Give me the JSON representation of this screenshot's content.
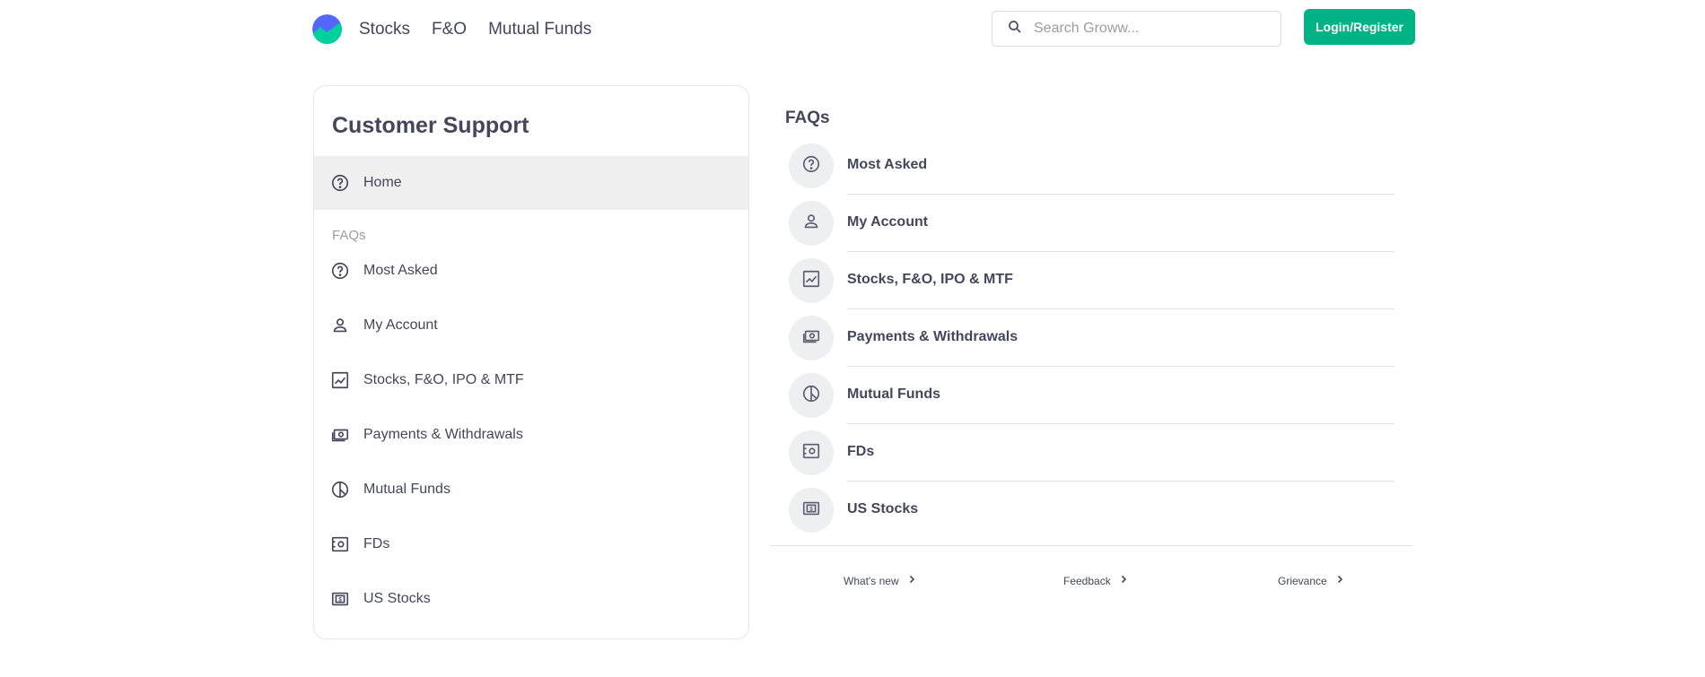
{
  "header": {
    "nav": [
      "Stocks",
      "F&O",
      "Mutual Funds"
    ],
    "search_placeholder": "Search Groww...",
    "login_label": "Login/Register"
  },
  "sidebar": {
    "title": "Customer Support",
    "home_label": "Home",
    "section_label": "FAQs",
    "items": [
      {
        "label": "Most Asked",
        "icon": "help-circle-icon"
      },
      {
        "label": "My Account",
        "icon": "user-icon"
      },
      {
        "label": "Stocks, F&O, IPO & MTF",
        "icon": "chart-line-icon"
      },
      {
        "label": "Payments & Withdrawals",
        "icon": "cash-icon"
      },
      {
        "label": "Mutual Funds",
        "icon": "pie-chart-icon"
      },
      {
        "label": "FDs",
        "icon": "safe-icon"
      },
      {
        "label": "US Stocks",
        "icon": "dollar-note-icon"
      }
    ]
  },
  "main": {
    "title": "FAQs",
    "items": [
      {
        "label": "Most Asked"
      },
      {
        "label": "My Account"
      },
      {
        "label": "Stocks, F&O, IPO & MTF"
      },
      {
        "label": "Payments & Withdrawals"
      },
      {
        "label": "Mutual Funds"
      },
      {
        "label": "FDs"
      },
      {
        "label": "US Stocks"
      }
    ],
    "footer_links": [
      "What's new",
      "Feedback",
      "Grievance"
    ]
  },
  "colors": {
    "accent": "#00b386",
    "text": "#44475b",
    "muted": "#9b9ca4",
    "highlight_bg": "#f0f0f1"
  }
}
